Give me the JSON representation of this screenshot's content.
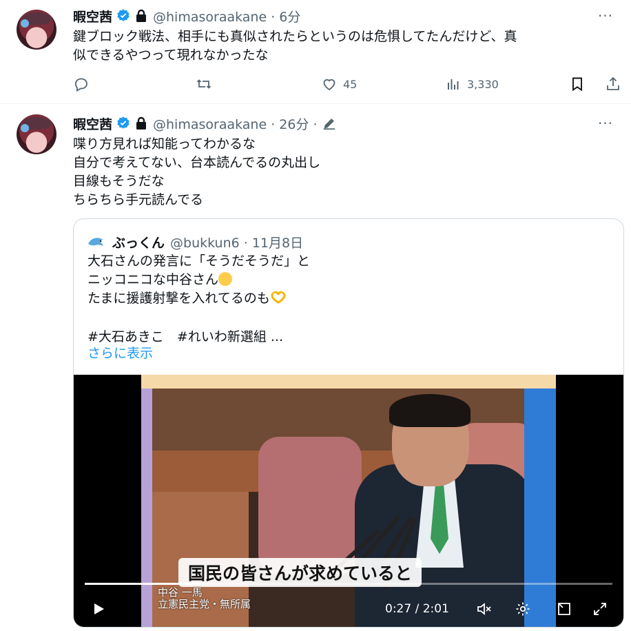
{
  "tweet1": {
    "name": "暇空茜",
    "handle": "@himasoraakane · 6分",
    "more": "···",
    "text_line1": "鍵ブロック戦法、相手にも真似されたらというのは危惧してたんだけど、真",
    "text_line2": "似できるやつって現れなかったな",
    "likes": "45",
    "views": "3,330"
  },
  "tweet2": {
    "name": "暇空茜",
    "handle": "@himasoraakane · 26分 ·",
    "more": "···",
    "lines": [
      "喋り方見れば知能ってわかるな",
      "自分で考えてない、台本読んでるの丸出し",
      "目線もそうだな",
      "ちらちら手元読んでる"
    ]
  },
  "quote": {
    "name": "ぶっくん",
    "handle": "@bukkun6 · 11月8日",
    "line1": "大石さんの発言に「そうだそうだ」と",
    "line2": "ニッコニコな中谷さん",
    "line3": "たまに援護射撃を入れてるのも",
    "hashtags": "#大石あきこ　#れいわ新選組 ...",
    "show_more": "さらに表示"
  },
  "video": {
    "subtitle": "国民の皆さんが求めていると",
    "caption_name": "中谷 一馬",
    "caption_party": "立憲民主党・無所属",
    "time": "0:27 / 2:01",
    "progress": 0.22
  },
  "colors": {
    "accent": "#1d9bf0",
    "muted": "#536471",
    "border": "#cfd9de"
  }
}
